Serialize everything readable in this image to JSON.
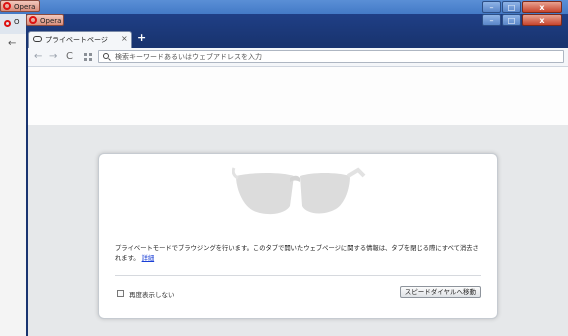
{
  "back_window": {
    "app_button_label": "Opera",
    "tab_text": "O"
  },
  "front_window": {
    "app_button_label": "Opera",
    "tab": {
      "title": "プライベートページ",
      "close": "×"
    },
    "new_tab": "+",
    "toolbar": {
      "back": "←",
      "forward": "→",
      "reload": "C",
      "address_placeholder": "検索キーワードあるいはウェブアドレスを入力"
    }
  },
  "window_controls": {
    "minimize": "–",
    "maximize": "□",
    "close": "x"
  },
  "private_panel": {
    "message": "プライベートモードでブラウジングを行います。このタブで開いたウェブページに関する情報は、タブを閉じる際にすべて消去されます。",
    "details_link": "詳細",
    "checkbox_label": "再度表示しない",
    "speed_dial_button": "スピードダイヤルへ移動"
  },
  "colors": {
    "titlebar_back": "#3d74c2",
    "titlebar_front": "#1f3f86",
    "close_button": "#c8452d",
    "opera_red": "#dd1111",
    "link": "#1a3fd6"
  }
}
